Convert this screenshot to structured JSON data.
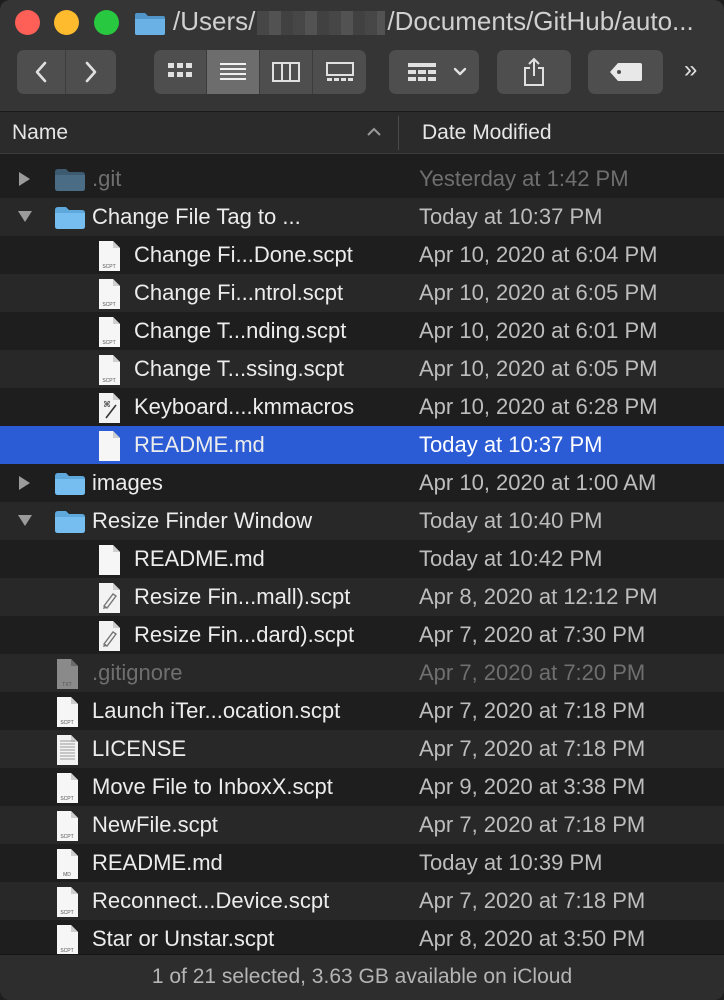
{
  "window": {
    "path_prefix": "/Users/",
    "path_suffix": "/Documents/GitHub/auto..."
  },
  "header": {
    "name_label": "Name",
    "date_label": "Date Modified"
  },
  "rows": [
    {
      "name": "LICENSE",
      "date": "Apr 7, 2020 at 7:18 PM",
      "type": "document",
      "level": 0
    }
  ],
  "files": [
    {
      "name": ".git",
      "date": "Yesterday at 1:42 PM",
      "kind": "folder",
      "level": 0,
      "disclosure": "collapsed",
      "dim": true
    },
    {
      "name": "Change File Tag to ...",
      "date": "Today at 10:37 PM",
      "kind": "folder",
      "level": 0,
      "disclosure": "expanded"
    },
    {
      "name": "Change Fi...Done.scpt",
      "date": "Apr 10, 2020 at 6:04 PM",
      "kind": "scpt",
      "level": 1
    },
    {
      "name": "Change Fi...ntrol.scpt",
      "date": "Apr 10, 2020 at 6:05 PM",
      "kind": "scpt",
      "level": 1
    },
    {
      "name": "Change T...nding.scpt",
      "date": "Apr 10, 2020 at 6:01 PM",
      "kind": "scpt",
      "level": 1
    },
    {
      "name": "Change T...ssing.scpt",
      "date": "Apr 10, 2020 at 6:05 PM",
      "kind": "scpt",
      "level": 1
    },
    {
      "name": "Keyboard....kmmacros",
      "date": "Apr 10, 2020 at 6:28 PM",
      "kind": "kmmacros",
      "level": 1
    },
    {
      "name": "README.md",
      "date": "Today at 10:37 PM",
      "kind": "doc",
      "level": 1,
      "selected": true
    },
    {
      "name": "images",
      "date": "Apr 10, 2020 at 1:00 AM",
      "kind": "folder",
      "level": 0,
      "disclosure": "collapsed"
    },
    {
      "name": "Resize Finder Window",
      "date": "Today at 10:40 PM",
      "kind": "folder",
      "level": 0,
      "disclosure": "expanded"
    },
    {
      "name": "README.md",
      "date": "Today at 10:42 PM",
      "kind": "doc",
      "level": 1
    },
    {
      "name": "Resize Fin...mall).scpt",
      "date": "Apr 8, 2020 at 12:12 PM",
      "kind": "script",
      "level": 1
    },
    {
      "name": "Resize Fin...dard).scpt",
      "date": "Apr 7, 2020 at 7:30 PM",
      "kind": "script",
      "level": 1
    },
    {
      "name": ".gitignore",
      "date": "Apr 7, 2020 at 7:20 PM",
      "kind": "txt",
      "level": 0,
      "dim": true
    },
    {
      "name": "Launch iTer...ocation.scpt",
      "date": "Apr 7, 2020 at 7:18 PM",
      "kind": "scpt",
      "level": 0
    },
    {
      "name": "LICENSE",
      "date": "Apr 7, 2020 at 7:18 PM",
      "kind": "text",
      "level": 0
    },
    {
      "name": "Move File to InboxX.scpt",
      "date": "Apr 9, 2020 at 3:38 PM",
      "kind": "scpt",
      "level": 0
    },
    {
      "name": "NewFile.scpt",
      "date": "Apr 7, 2020 at 7:18 PM",
      "kind": "scpt",
      "level": 0
    },
    {
      "name": "README.md",
      "date": "Today at 10:39 PM",
      "kind": "md",
      "level": 0
    },
    {
      "name": "Reconnect...Device.scpt",
      "date": "Apr 7, 2020 at 7:18 PM",
      "kind": "scpt",
      "level": 0
    },
    {
      "name": "Star or Unstar.scpt",
      "date": "Apr 8, 2020 at 3:50 PM",
      "kind": "scpt",
      "level": 0
    }
  ],
  "file_badges": {
    "scpt": "SCPT",
    "txt": "TXT",
    "md": "MD"
  },
  "status": {
    "text": "1 of 21 selected, 3.63 GB available on iCloud"
  },
  "colors": {
    "selection": "#2b5cd6",
    "folder": "#5fa8dc",
    "close": "#fe5f57",
    "minimize": "#febb2e",
    "zoom": "#28c840"
  }
}
